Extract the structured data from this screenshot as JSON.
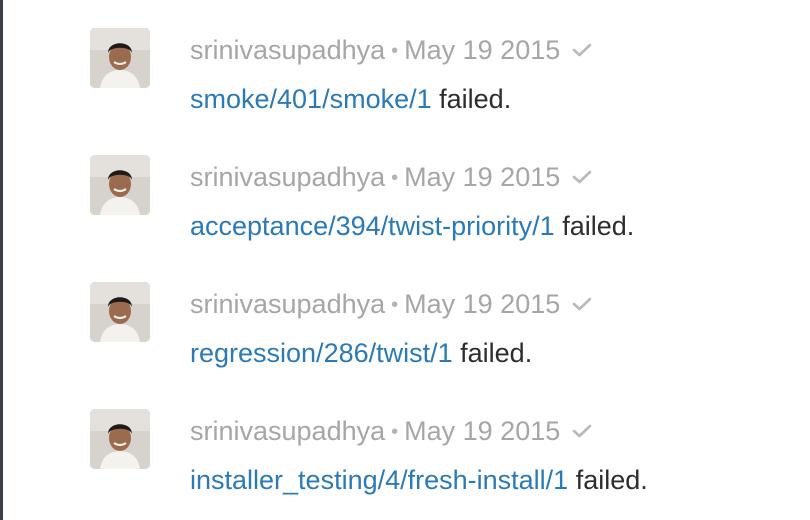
{
  "activity_feed": {
    "items": [
      {
        "user": "srinivasupadhya",
        "separator": "•",
        "date": "May 19 2015",
        "link_text": "smoke/401/smoke/1",
        "status_text": "failed."
      },
      {
        "user": "srinivasupadhya",
        "separator": "•",
        "date": "May 19 2015",
        "link_text": "acceptance/394/twist-priority/1",
        "status_text": "failed."
      },
      {
        "user": "srinivasupadhya",
        "separator": "•",
        "date": "May 19 2015",
        "link_text": "regression/286/twist/1",
        "status_text": "failed."
      },
      {
        "user": "srinivasupadhya",
        "separator": "•",
        "date": "May 19 2015",
        "link_text": "installer_testing/4/fresh-install/1",
        "status_text": "failed."
      }
    ]
  },
  "colors": {
    "link": "#2a7ab8",
    "meta_text": "#a6a6a6",
    "body_text": "#2d2d2d",
    "left_rule": "#3b4047"
  },
  "icons": {
    "avatar": "user-avatar-photo",
    "status": "check-icon"
  }
}
